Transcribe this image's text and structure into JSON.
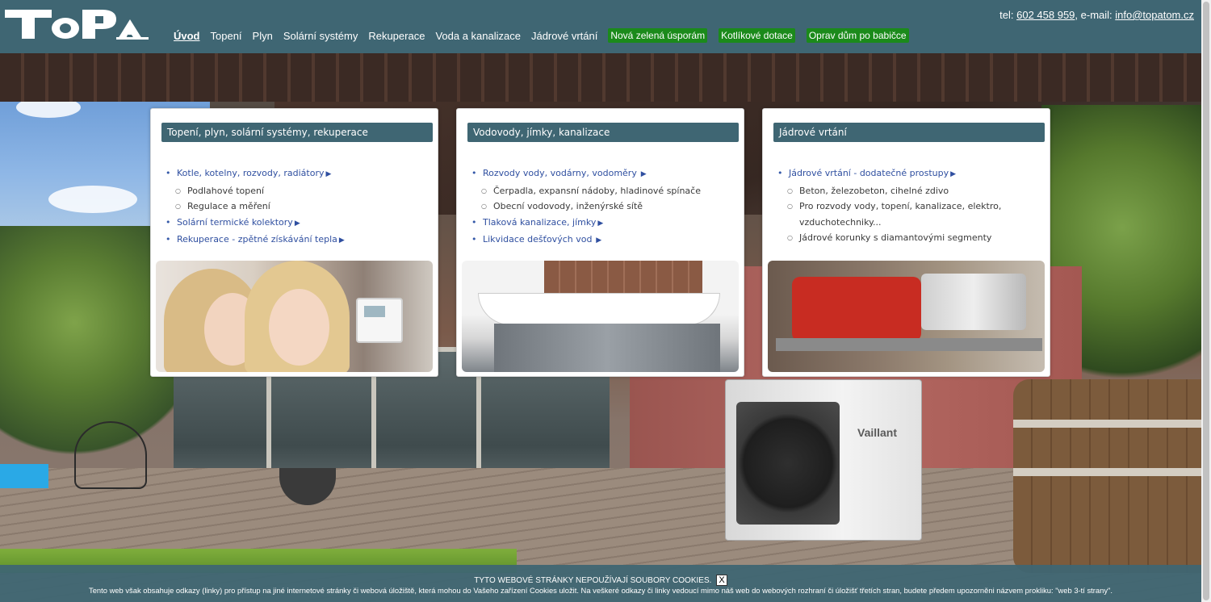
{
  "header": {
    "logo_text": "TOPA",
    "nav": [
      {
        "label": "Úvod",
        "active": true,
        "green": false
      },
      {
        "label": "Topení",
        "active": false,
        "green": false
      },
      {
        "label": "Plyn",
        "active": false,
        "green": false
      },
      {
        "label": "Solární systémy",
        "active": false,
        "green": false
      },
      {
        "label": "Rekuperace",
        "active": false,
        "green": false
      },
      {
        "label": "Voda a kanalizace",
        "active": false,
        "green": false
      },
      {
        "label": "Jádrové vrtání",
        "active": false,
        "green": false
      },
      {
        "label": "Nová zelená úsporám",
        "active": false,
        "green": true
      },
      {
        "label": "Kotlíkové dotace",
        "active": false,
        "green": true
      },
      {
        "label": "Oprav dům po babičce",
        "active": false,
        "green": true
      }
    ],
    "contact": {
      "tel_prefix": "tel: ",
      "phone": "602 458 959",
      "email_prefix": ", e-mail: ",
      "email": "info@topatom.cz"
    }
  },
  "cards": [
    {
      "title": "Topení, plyn, solární systémy, rekuperace",
      "items": [
        {
          "level": 1,
          "label": "Kotle, kotelny, rozvody, radiátory",
          "link": true
        },
        {
          "level": 2,
          "label": "Podlahové topení",
          "link": false
        },
        {
          "level": 2,
          "label": "Regulace a měření",
          "link": false
        },
        {
          "level": 1,
          "label": "Solární termické kolektory",
          "link": true
        },
        {
          "level": 1,
          "label": "Rekuperace - zpětné získávání tepla",
          "link": true
        }
      ]
    },
    {
      "title": "Vodovody, jímky, kanalizace",
      "items": [
        {
          "level": 1,
          "label": "Rozvody vody, vodárny, vodoměry",
          "link": true
        },
        {
          "level": 2,
          "label": "Čerpadla, expansní nádoby, hladinové spínače",
          "link": false
        },
        {
          "level": 2,
          "label": "Obecní vodovody, inženýrské sítě",
          "link": false
        },
        {
          "level": 1,
          "label": "Tlaková kanalizace, jímky",
          "link": true
        },
        {
          "level": 1,
          "label": "Likvidace dešťových vod",
          "link": true
        }
      ]
    },
    {
      "title": "Jádrové vrtání",
      "items": [
        {
          "level": 1,
          "label": "Jádrové vrtání - dodatečné prostupy",
          "link": true
        },
        {
          "level": 2,
          "label": "Beton, železobeton, cihelné zdivo",
          "link": false
        },
        {
          "level": 2,
          "label": "Pro rozvody vody, topení, kanalizace, elektro, vzduchotechniky...",
          "link": false
        },
        {
          "level": 2,
          "label": "Jádrové korunky s diamantovými segmenty",
          "link": false
        }
      ]
    }
  ],
  "background": {
    "brand_on_unit": "Vaillant"
  },
  "cookie": {
    "title": "TYTO WEBOVÉ STRÁNKY NEPOUŽÍVAJÍ SOUBORY COOKIES.",
    "close_label": "X",
    "text": "Tento web však obsahuje odkazy (linky) pro přístup na jiné internetové stránky či webová úložiště, která mohou do Vašeho zařízení Cookies uložit. Na veškeré odkazy či linky vedoucí mimo náš web do webových rozhraní či úložišť třetích stran, budete předem upozorněni názvem prokliku: \"web 3-tí strany\"."
  },
  "colors": {
    "header_bg": "#3f6673",
    "nav_green": "#1b8a1b",
    "link_blue": "#2f4fa0"
  }
}
